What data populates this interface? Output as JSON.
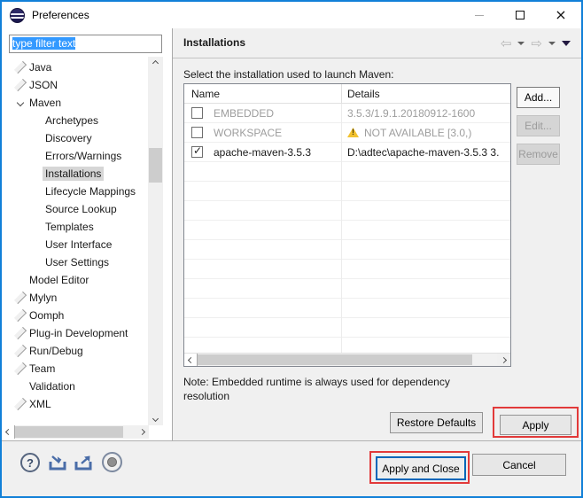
{
  "window": {
    "title": "Preferences"
  },
  "icons": {
    "close": "×",
    "back": "⇦",
    "forward": "⇨",
    "help": "?"
  },
  "colors": {
    "window_border": "#1180d8",
    "selection_blue": "#3399ff",
    "tree_selection_gray": "#d6d6d6",
    "annotation_red": "#e23a3a",
    "focus_button_border": "#0066b8",
    "warning_yellow": "#f2c230",
    "disabled_text": "#9d9d9d"
  },
  "sidebar": {
    "filter_text": "type filter text",
    "items": [
      {
        "label": "Java",
        "level": 0,
        "expander": "collapsed",
        "selected": false
      },
      {
        "label": "JSON",
        "level": 0,
        "expander": "collapsed",
        "selected": false
      },
      {
        "label": "Maven",
        "level": 0,
        "expander": "expanded",
        "selected": false
      },
      {
        "label": "Archetypes",
        "level": 1,
        "expander": "none",
        "selected": false
      },
      {
        "label": "Discovery",
        "level": 1,
        "expander": "none",
        "selected": false
      },
      {
        "label": "Errors/Warnings",
        "level": 1,
        "expander": "none",
        "selected": false
      },
      {
        "label": "Installations",
        "level": 1,
        "expander": "none",
        "selected": true
      },
      {
        "label": "Lifecycle Mappings",
        "level": 1,
        "expander": "none",
        "selected": false
      },
      {
        "label": "Source Lookup",
        "level": 1,
        "expander": "none",
        "selected": false
      },
      {
        "label": "Templates",
        "level": 1,
        "expander": "none",
        "selected": false
      },
      {
        "label": "User Interface",
        "level": 1,
        "expander": "none",
        "selected": false
      },
      {
        "label": "User Settings",
        "level": 1,
        "expander": "none",
        "selected": false
      },
      {
        "label": "Model Editor",
        "level": 0,
        "expander": "none",
        "selected": false
      },
      {
        "label": "Mylyn",
        "level": 0,
        "expander": "collapsed",
        "selected": false
      },
      {
        "label": "Oomph",
        "level": 0,
        "expander": "collapsed",
        "selected": false
      },
      {
        "label": "Plug-in Development",
        "level": 0,
        "expander": "collapsed",
        "selected": false
      },
      {
        "label": "Run/Debug",
        "level": 0,
        "expander": "collapsed",
        "selected": false
      },
      {
        "label": "Team",
        "level": 0,
        "expander": "collapsed",
        "selected": false
      },
      {
        "label": "Validation",
        "level": 0,
        "expander": "none",
        "selected": false
      },
      {
        "label": "XML",
        "level": 0,
        "expander": "collapsed",
        "selected": false
      }
    ]
  },
  "main": {
    "header": "Installations",
    "instruction": "Select the installation used to launch Maven:",
    "table": {
      "columns": [
        "Name",
        "Details"
      ],
      "rows": [
        {
          "checked": false,
          "name": "EMBEDDED",
          "details": "3.5.3/1.9.1.20180912-1600",
          "disabled": true,
          "warning": false
        },
        {
          "checked": false,
          "name": "WORKSPACE",
          "details": "NOT AVAILABLE [3.0,)",
          "disabled": true,
          "warning": true
        },
        {
          "checked": true,
          "name": "apache-maven-3.5.3",
          "details": "D:\\adtec\\apache-maven-3.5.3 3.",
          "disabled": false,
          "warning": false
        }
      ]
    },
    "side_buttons": {
      "add": "Add...",
      "edit": "Edit...",
      "remove": "Remove"
    },
    "note": "Note: Embedded runtime is always used for dependency resolution",
    "restore_defaults_label": "Restore Defaults",
    "apply_label": "Apply"
  },
  "footer": {
    "apply_and_close_label": "Apply and Close",
    "cancel_label": "Cancel"
  }
}
